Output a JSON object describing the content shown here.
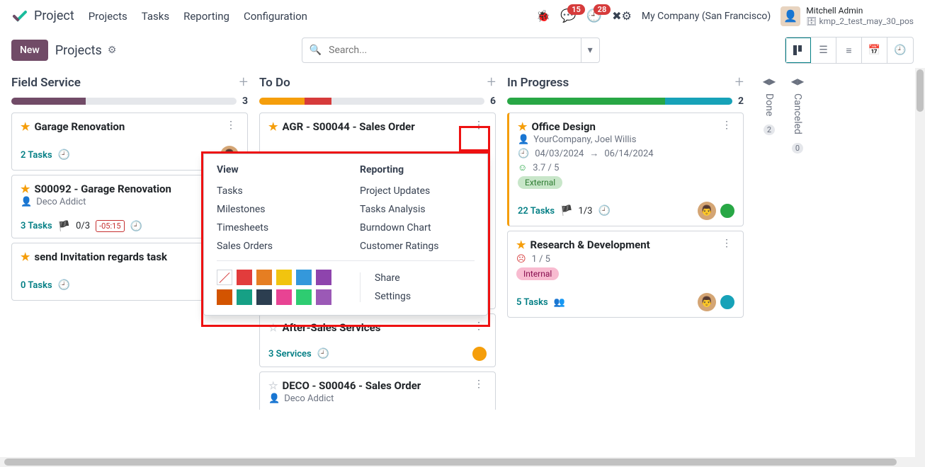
{
  "app": {
    "name": "Project"
  },
  "nav": {
    "projects": "Projects",
    "tasks": "Tasks",
    "reporting": "Reporting",
    "configuration": "Configuration"
  },
  "header": {
    "messages_count": "15",
    "activities_count": "28",
    "company": "My Company (San Francisco)",
    "user_name": "Mitchell Admin",
    "db_name": "kmp_2_test_may_30_pos"
  },
  "controls": {
    "new_label": "New",
    "breadcrumb": "Projects",
    "search_placeholder": "Search..."
  },
  "columns": {
    "field_service": {
      "title": "Field Service",
      "count": "3"
    },
    "todo": {
      "title": "To Do",
      "count": "6"
    },
    "in_progress": {
      "title": "In Progress",
      "count": "2"
    },
    "done": {
      "title": "Done",
      "count": "2"
    },
    "canceled": {
      "title": "Canceled",
      "count": "0"
    }
  },
  "cards": {
    "fs1": {
      "title": "Garage Renovation",
      "footer": "2 Tasks"
    },
    "fs2": {
      "title": "S00092 - Garage Renovation",
      "sub": "Deco Addict",
      "footer": "3 Tasks",
      "milestones": "0/3",
      "badge": "-05:15"
    },
    "fs3": {
      "title": "send Invitation regards task",
      "footer": "0 Tasks"
    },
    "td1": {
      "title": "AGR - S00044 - Sales Order"
    },
    "td2": {
      "title": "After-Sales Services",
      "footer": "3 Services"
    },
    "td3": {
      "title": "DECO - S00046 - Sales Order",
      "sub": "Deco Addict"
    },
    "ip1": {
      "title": "Office Design",
      "sub": "YourCompany, Joel Willis",
      "date_from": "04/03/2024",
      "date_to": "06/14/2024",
      "rating": "3.7 / 5",
      "tag": "External",
      "footer": "22 Tasks",
      "milestones": "1/3"
    },
    "ip2": {
      "title": "Research & Development",
      "rating": "1 / 5",
      "tag": "Internal",
      "footer": "5 Tasks"
    }
  },
  "dropdown": {
    "view_head": "View",
    "reporting_head": "Reporting",
    "tasks": "Tasks",
    "milestones": "Milestones",
    "timesheets": "Timesheets",
    "sales_orders": "Sales Orders",
    "project_updates": "Project Updates",
    "tasks_analysis": "Tasks Analysis",
    "burndown": "Burndown Chart",
    "ratings": "Customer Ratings",
    "share": "Share",
    "settings": "Settings",
    "colors": [
      "#ffffff",
      "#e23c3c",
      "#e67e22",
      "#f1c40f",
      "#3498db",
      "#8e44ad",
      "#d35400",
      "#16a085",
      "#2c3e50",
      "#e84393",
      "#2ecc71",
      "#9b59b6"
    ]
  }
}
